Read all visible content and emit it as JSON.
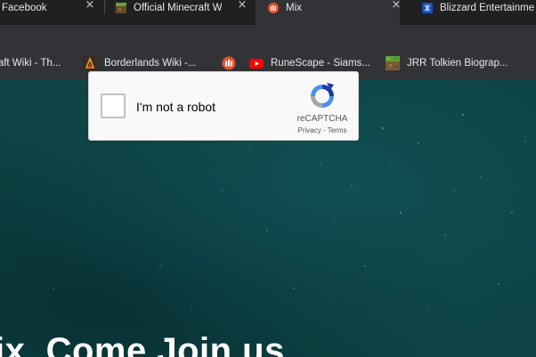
{
  "tabs": [
    {
      "label": "Facebook",
      "icon": "facebook-icon"
    },
    {
      "label": "Official Minecraft W",
      "icon": "minecraft-icon"
    },
    {
      "label": "Mix",
      "icon": "mix-icon",
      "active": true
    },
    {
      "label": "Blizzard Entertainme",
      "icon": "blizzard-icon"
    }
  ],
  "bookmarks": [
    {
      "label": "raft Wiki - Th...",
      "icon": ""
    },
    {
      "label": "Borderlands Wiki -...",
      "icon": "borderlands-icon"
    },
    {
      "label": "",
      "icon": "mix-icon"
    },
    {
      "label": "RuneScape - Siams...",
      "icon": "youtube-icon"
    },
    {
      "label": "JRR Tolkien Biograp...",
      "icon": "minecraft-icon"
    }
  ],
  "recaptcha": {
    "label": "I'm not a robot",
    "brand": "reCAPTCHA",
    "links": "Privacy - Terms",
    "checked": false
  },
  "hero": {
    "text": "ix. Come Join us"
  },
  "colors": {
    "tabstrip": "#1f2022",
    "toolbar": "#323337",
    "page_bg": "#0e4446",
    "mix_orange": "#e2552d",
    "youtube_red": "#ff0000",
    "recaptcha_blue": "#1c3aa9"
  }
}
